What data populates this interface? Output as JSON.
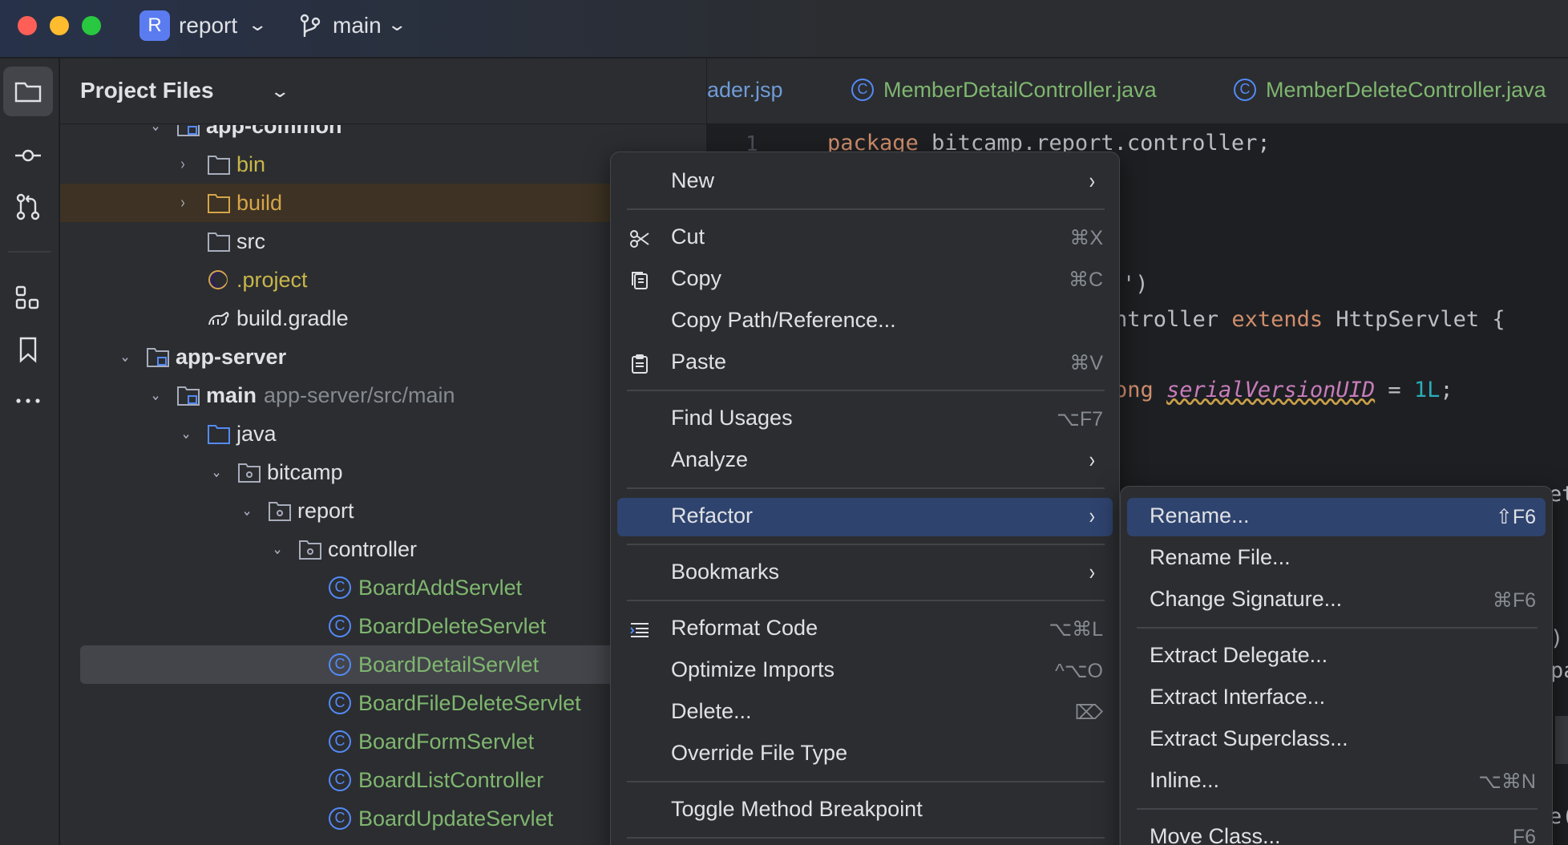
{
  "titlebar": {
    "project_badge": "R",
    "project_name": "report",
    "branch_name": "main"
  },
  "toolstrip": {
    "tools": [
      "folder-icon",
      "commit-icon",
      "pull-request-icon",
      "structure-icon",
      "bookmark-icon",
      "more-icon"
    ]
  },
  "project_panel": {
    "title": "Project Files",
    "rows": [
      {
        "label": "app-common",
        "type": "module"
      },
      {
        "label": "bin",
        "type": "folder"
      },
      {
        "label": "build",
        "type": "folder"
      },
      {
        "label": "src",
        "type": "folder"
      },
      {
        "label": ".project",
        "type": "file"
      },
      {
        "label": "build.gradle",
        "type": "gradle"
      },
      {
        "label": "app-server",
        "type": "module"
      },
      {
        "label": "main",
        "hint": "app-server/src/main",
        "type": "source-root"
      },
      {
        "label": "java",
        "type": "folder"
      },
      {
        "label": "bitcamp",
        "type": "package"
      },
      {
        "label": "report",
        "type": "package"
      },
      {
        "label": "controller",
        "type": "package"
      },
      {
        "label": "BoardAddServlet",
        "type": "class"
      },
      {
        "label": "BoardDeleteServlet",
        "type": "class"
      },
      {
        "label": "BoardDetailServlet",
        "type": "class",
        "selected": true
      },
      {
        "label": "BoardFileDeleteServlet",
        "type": "class"
      },
      {
        "label": "BoardFormServlet",
        "type": "class"
      },
      {
        "label": "BoardListController",
        "type": "class"
      },
      {
        "label": "BoardUpdateServlet",
        "type": "class"
      }
    ]
  },
  "editor": {
    "tabs": [
      {
        "label": "ader.jsp"
      },
      {
        "label": "MemberDetailController.java"
      },
      {
        "label": "MemberDeleteController.java"
      }
    ],
    "line_number": "1",
    "code": {
      "line1_kw": "package",
      "line1_rest": " bitcamp.report.controller;",
      "frag_paren": "')",
      "frag_class_a": "ntroller ",
      "frag_class_kw": "extends",
      "frag_class_b": " HttpServlet {",
      "frag_field_kw": "ong ",
      "frag_field_name": "serialVersionUID",
      "frag_field_eq": " = ",
      "frag_field_num": "1L",
      "frag_field_end": ";",
      "frag_right1": "et",
      "frag_right2": ").",
      "frag_right3": "pa",
      "frag_right4": "e("
    }
  },
  "context_menu": {
    "items": [
      {
        "label": "New",
        "submenu": true
      },
      {
        "label": "Cut",
        "shortcut": "⌘X",
        "icon": "scissors-icon"
      },
      {
        "label": "Copy",
        "shortcut": "⌘C",
        "icon": "copy-icon"
      },
      {
        "label": "Copy Path/Reference..."
      },
      {
        "label": "Paste",
        "shortcut": "⌘V",
        "icon": "paste-icon"
      },
      {
        "label": "Find Usages",
        "shortcut": "⌥F7"
      },
      {
        "label": "Analyze",
        "submenu": true
      },
      {
        "label": "Refactor",
        "submenu": true,
        "active": true
      },
      {
        "label": "Bookmarks",
        "submenu": true
      },
      {
        "label": "Reformat Code",
        "shortcut": "⌥⌘L",
        "icon": "reformat-icon"
      },
      {
        "label": "Optimize Imports",
        "shortcut": "^⌥O"
      },
      {
        "label": "Delete...",
        "shortcut": "⌦"
      },
      {
        "label": "Override File Type"
      },
      {
        "label": "Toggle Method Breakpoint"
      }
    ]
  },
  "refactor_submenu": {
    "items": [
      {
        "label": "Rename...",
        "shortcut": "⇧F6",
        "active": true
      },
      {
        "label": "Rename File..."
      },
      {
        "label": "Change Signature...",
        "shortcut": "⌘F6"
      },
      {
        "label": "Extract Delegate..."
      },
      {
        "label": "Extract Interface..."
      },
      {
        "label": "Extract Superclass..."
      },
      {
        "label": "Inline...",
        "shortcut": "⌥⌘N"
      },
      {
        "label": "Move Class...",
        "shortcut": "F6"
      }
    ]
  },
  "colors": {
    "accent_selection": "#2e436e",
    "class_icon": "#548af7",
    "green_file": "#7fb66f",
    "yellow_folder": "#c8b64b",
    "orange_folder": "#d5a54a"
  }
}
